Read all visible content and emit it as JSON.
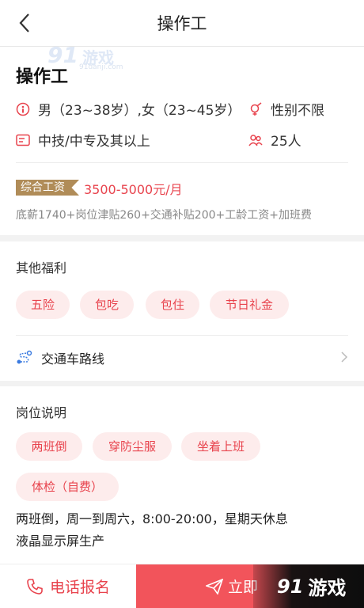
{
  "header": {
    "title": "操作工"
  },
  "watermark": {
    "brand": "91",
    "name": "游戏",
    "url": "91danji.com"
  },
  "job": {
    "title": "操作工",
    "age_requirement": "男（23~38岁）,女（23~45岁）",
    "gender": "性别不限",
    "education": "中技/中专及其以上",
    "headcount": "25人",
    "salary_badge": "综合工资",
    "salary_range": "3500-5000元/月",
    "salary_detail": "底薪1740+岗位津贴260+交通补贴200+工龄工资+加班费"
  },
  "benefits": {
    "title": "其他福利",
    "tags": [
      "五险",
      "包吃",
      "包住",
      "节日礼金"
    ]
  },
  "route": {
    "label": "交通车路线"
  },
  "position": {
    "title": "岗位说明",
    "tags": [
      "两班倒",
      "穿防尘服",
      "坐着上班",
      "体检（自费）"
    ],
    "desc_line1": "两班倒，周一到周六，8:00-20:00，星期天休息",
    "desc_line2": "液晶显示屏生产"
  },
  "bottom": {
    "call_label": "电话报名",
    "apply_label": "立即",
    "logo_brand": "91",
    "logo_name": "游戏"
  },
  "colors": {
    "accent": "#e8434d",
    "badge": "#b08c58",
    "apply": "#f2545b"
  }
}
